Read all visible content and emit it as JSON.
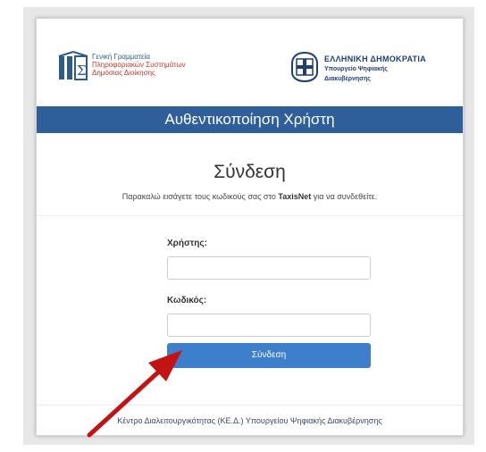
{
  "header": {
    "gsis_lines": [
      "Γενική Γραμματεία",
      "Πληροφοριακών Συστημάτων",
      "Δημόσιας Διοίκησης"
    ],
    "republic_title": "ΕΛΛΗΝΙΚΗ ΔΗΜΟΚΡΑΤΙΑ",
    "ministry_lines": [
      "Υπουργείο Ψηφιακής",
      "Διακυβέρνησης"
    ]
  },
  "titlebar": "Αυθεντικοποίηση Χρήστη",
  "login": {
    "title": "Σύνδεση",
    "instr_before": "Παρακαλώ εισάγετε τους κωδικούς σας στο ",
    "instr_brand": "TaxisNet",
    "instr_after": " για να συνδεθείτε.",
    "username_label": "Χρήστης:",
    "username_value": "",
    "password_label": "Κωδικός:",
    "password_value": "",
    "submit_label": "Σύνδεση"
  },
  "footer": "Κέντρο Διαλειτουργικότητας (ΚΕ.Δ.) Υπουργείου Ψηφιακής Διακυβέρνησης",
  "colors": {
    "titlebar": "#2f5f9a",
    "button": "#3d7fcb",
    "arrow": "#c41313"
  }
}
